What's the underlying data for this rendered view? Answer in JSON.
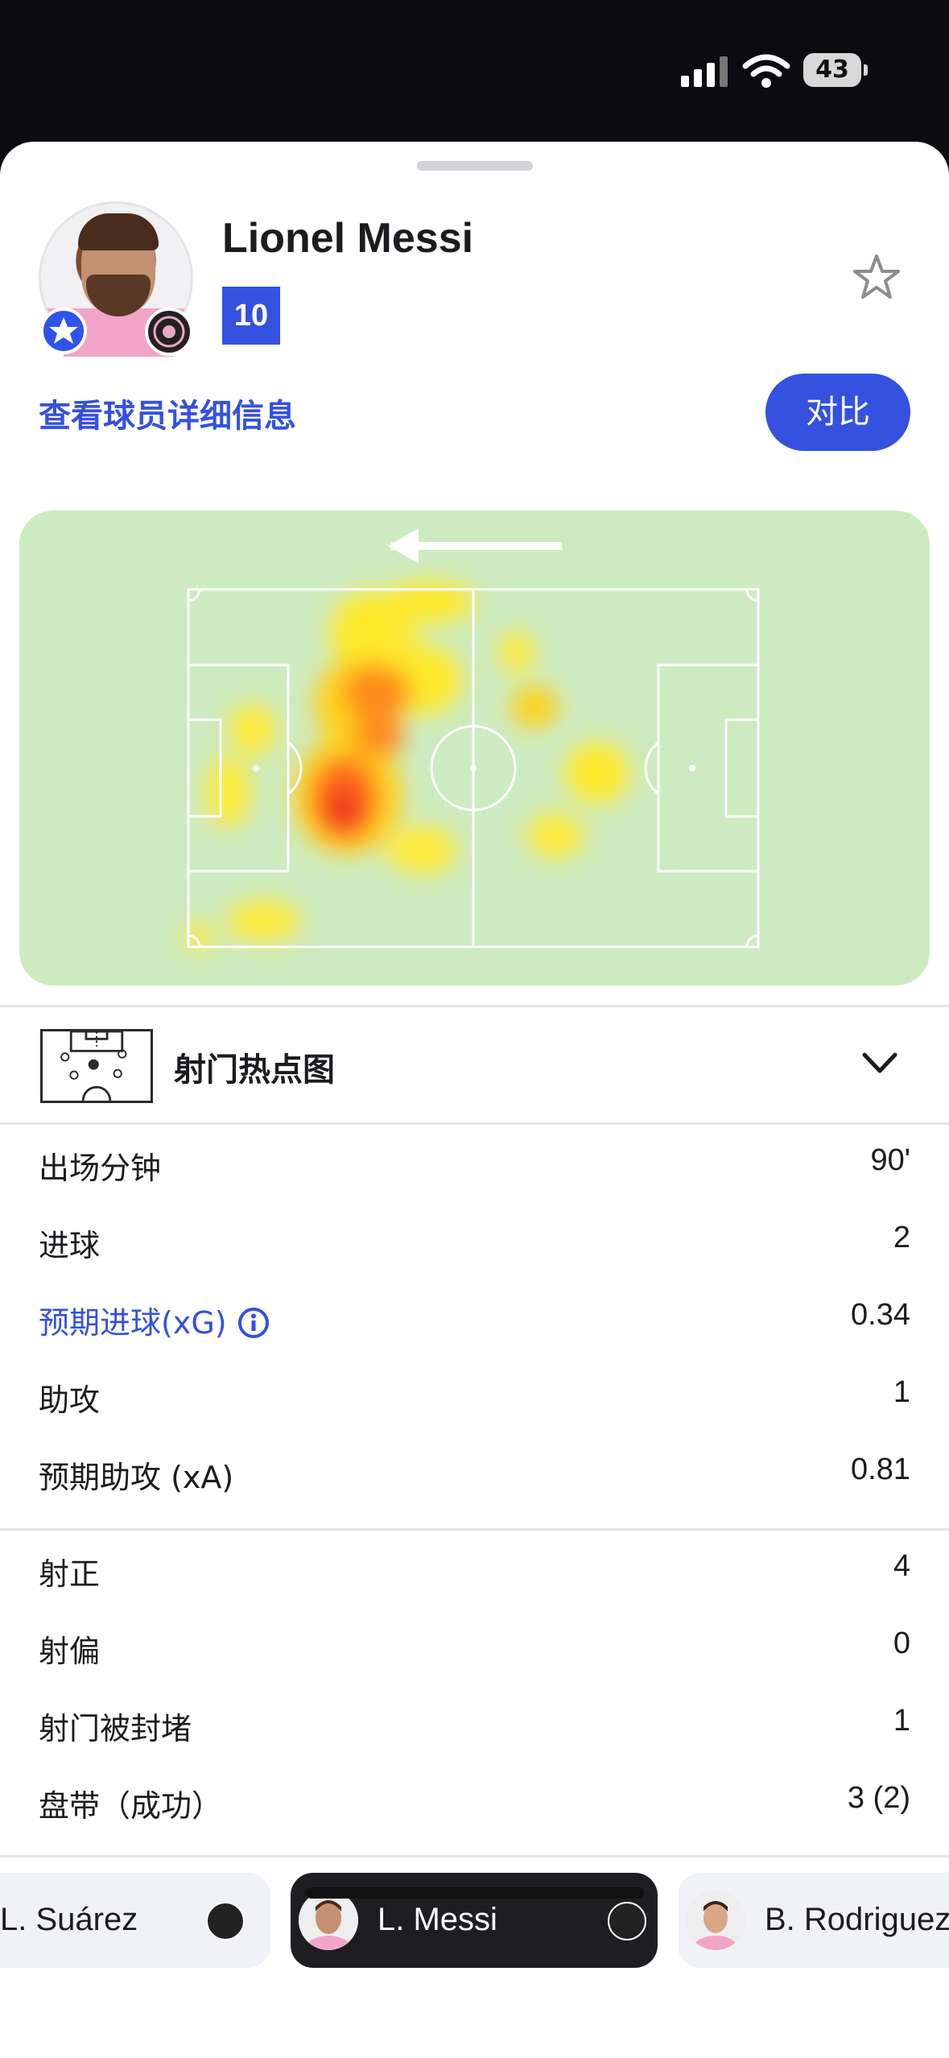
{
  "status_bar": {
    "battery": "43"
  },
  "player": {
    "name": "Lionel Messi",
    "number": "10",
    "detail_link": "查看球员详细信息",
    "compare_button": "对比"
  },
  "shot_map": {
    "label": "射门热点图"
  },
  "stats_primary": [
    {
      "label": "出场分钟",
      "value": "90'"
    },
    {
      "label": "进球",
      "value": "2"
    },
    {
      "label": "预期进球(xG)",
      "value": "0.34",
      "highlight": true
    },
    {
      "label": "助攻",
      "value": "1"
    },
    {
      "label": "预期助攻 (xA)",
      "value": "0.81"
    }
  ],
  "stats_secondary": [
    {
      "label": "射正",
      "value": "4"
    },
    {
      "label": "射偏",
      "value": "0"
    },
    {
      "label": "射门被封堵",
      "value": "1"
    },
    {
      "label": "盘带（成功）",
      "value": "3 (2)"
    }
  ],
  "carousel": [
    {
      "name": "L. Suárez",
      "active": false
    },
    {
      "name": "L. Messi",
      "active": true
    },
    {
      "name": "B. Rodriguez",
      "active": false
    }
  ],
  "colors": {
    "accent": "#3451e0",
    "pitch": "#cdebc0",
    "active_chip": "#1e1e22"
  }
}
